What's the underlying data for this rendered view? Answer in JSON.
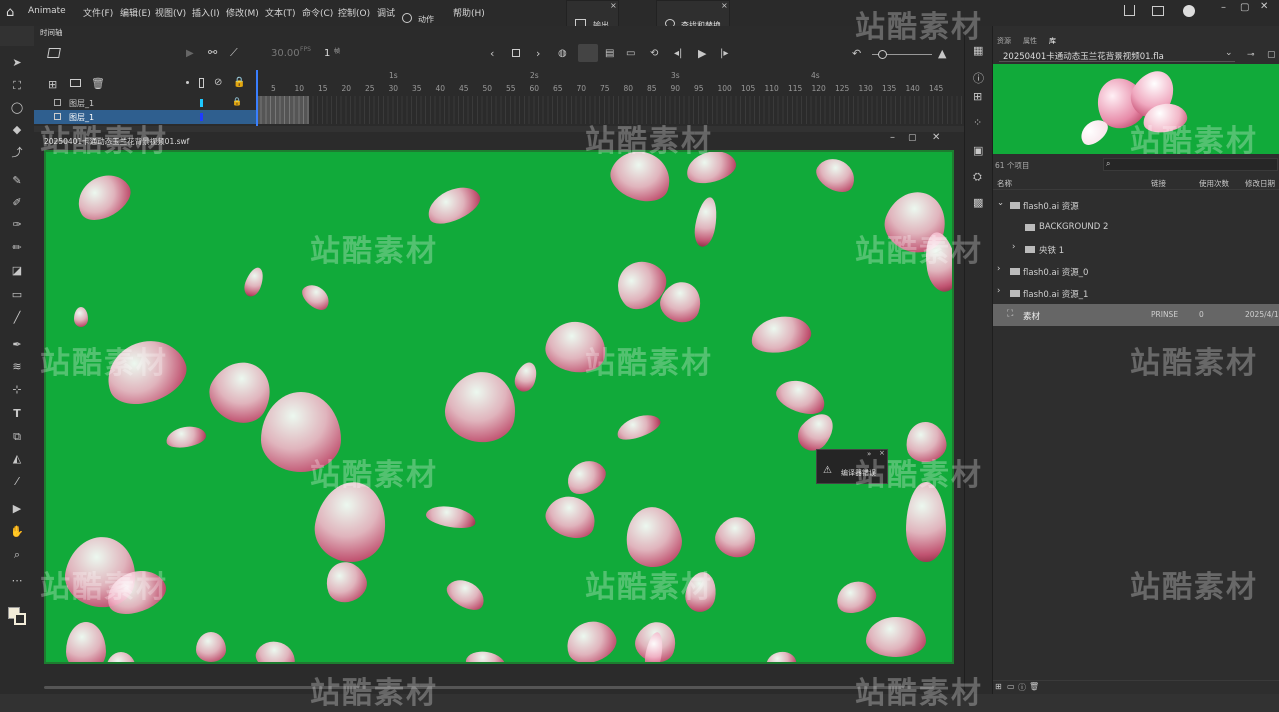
{
  "app": {
    "name": "Animate",
    "menus": [
      "文件(F)",
      "编辑(E)",
      "视图(V)",
      "插入(I)",
      "修改(M)",
      "文本(T)",
      "命令(C)",
      "控制(O)",
      "调试",
      "帮助(H)"
    ]
  },
  "floating_tabs": {
    "actions": "动作",
    "output": "输出",
    "find_replace": "查找和替换"
  },
  "timeline": {
    "tab_label": "时间轴",
    "fps": "30.00",
    "fps_unit": "FPS",
    "current_frame": "1",
    "frame_unit": "帧",
    "layers": [
      {
        "name": "图层_1",
        "color": "#1ec8ff",
        "selected": false
      },
      {
        "name": "图层_1",
        "color": "#1e3cff",
        "selected": true
      }
    ],
    "second_markers": [
      "1s",
      "2s",
      "3s",
      "4s"
    ],
    "frame_numbers": [
      "5",
      "10",
      "15",
      "20",
      "25",
      "30",
      "35",
      "40",
      "45",
      "50",
      "55",
      "60",
      "65",
      "70",
      "75",
      "80",
      "85",
      "90",
      "95",
      "100",
      "105",
      "110",
      "115",
      "120",
      "125",
      "130",
      "135",
      "140",
      "145"
    ]
  },
  "stage_window": {
    "title": "20250401卡通动态玉兰花背景视频01.swf",
    "background_color": "#11aa3a"
  },
  "compiler_popup": {
    "label": "编译器错误"
  },
  "library": {
    "tabs": [
      "资源",
      "属性",
      "库"
    ],
    "document": "20250401卡通动态玉兰花背景视频01.fla",
    "item_count": "61 个项目",
    "columns": [
      "名称",
      "链接",
      "使用次数",
      "修改日期"
    ],
    "items": [
      {
        "name": "flash0.ai 资源",
        "type": "folder",
        "expanded": true,
        "indent": 0
      },
      {
        "name": "BACKGROUND 2",
        "type": "folder",
        "expanded": false,
        "indent": 2
      },
      {
        "name": "央铁 1",
        "type": "folder",
        "expanded": false,
        "indent": 1
      },
      {
        "name": "flash0.ai 资源_0",
        "type": "folder",
        "expanded": false,
        "indent": 0
      },
      {
        "name": "flash0.ai 资源_1",
        "type": "folder",
        "expanded": false,
        "indent": 0
      },
      {
        "name": "素材",
        "type": "movie",
        "linkage": "PRINSE",
        "use_count": "0",
        "date": "2025/4/1",
        "selected": true,
        "indent": 0
      }
    ]
  },
  "watermark_text": "站酷素材"
}
